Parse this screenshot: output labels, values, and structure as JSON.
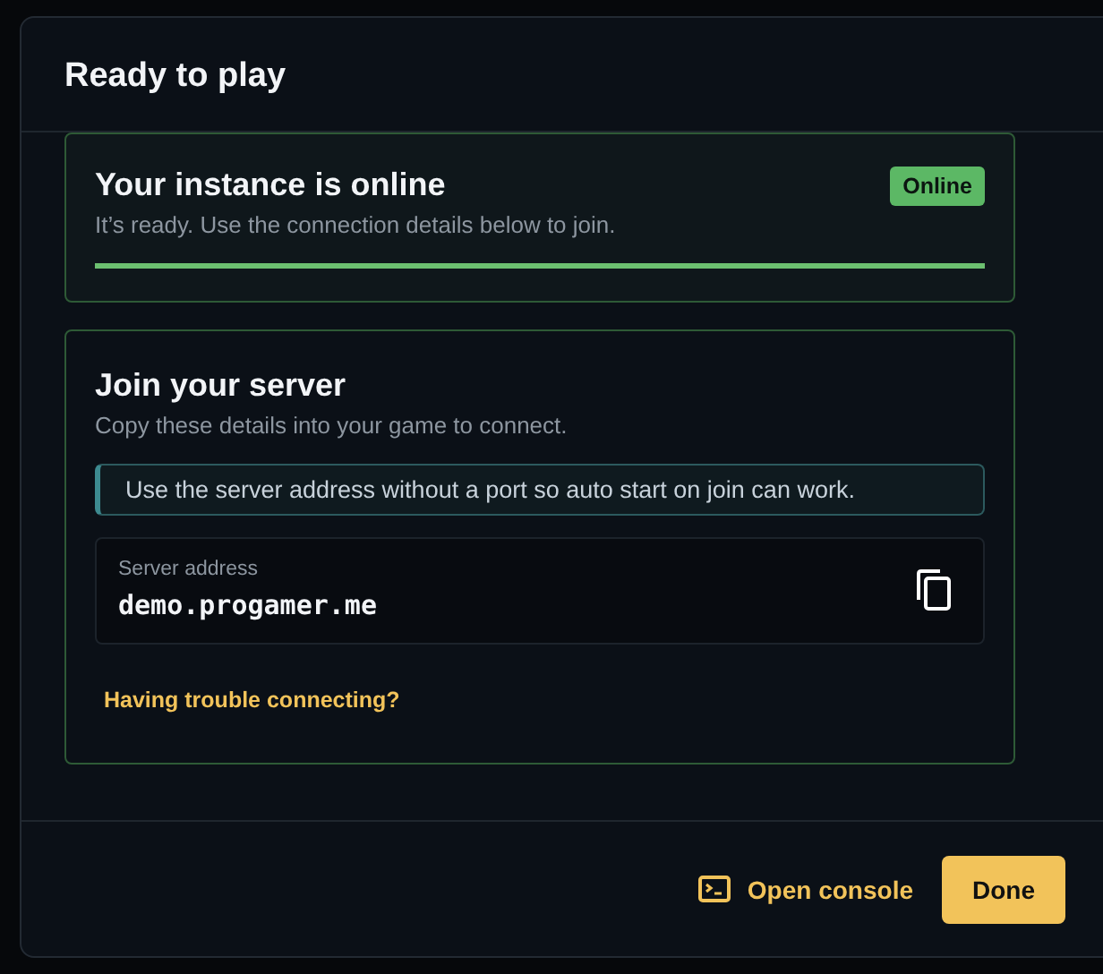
{
  "dialog": {
    "title": "Ready to play"
  },
  "status_card": {
    "title": "Your instance is online",
    "subtitle": "It’s ready. Use the connection details below to join.",
    "badge": "Online",
    "level": 1
  },
  "join_card": {
    "title": "Join your server",
    "subtitle": "Copy these details into your game to connect.",
    "notice": "Use the server address without a port so auto start on join can work.",
    "address_label": "Server address",
    "address": "demo.progamer.me",
    "help_link": "Having trouble connecting?"
  },
  "footer": {
    "console_button": "Open console",
    "done_button": "Done"
  }
}
